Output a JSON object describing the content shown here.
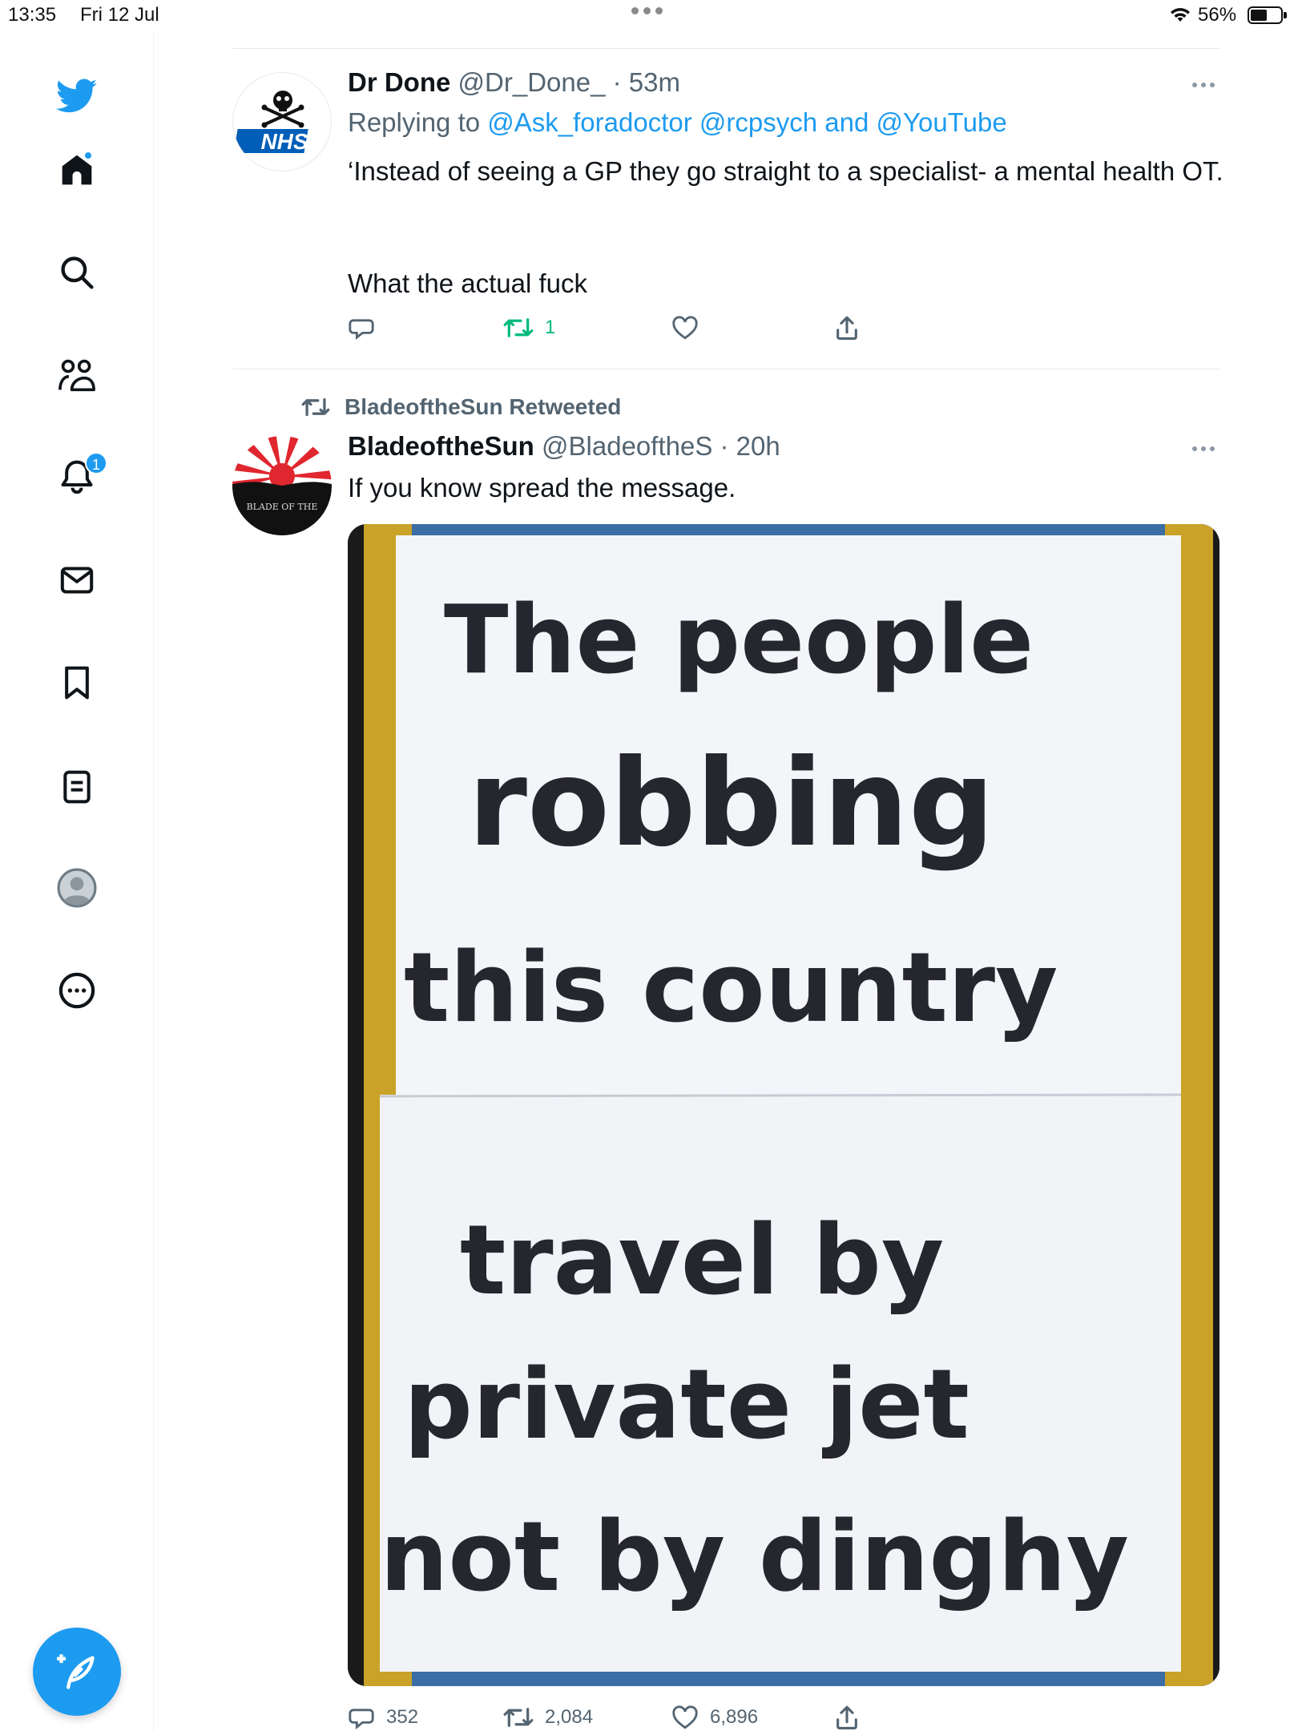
{
  "status_bar": {
    "time": "13:35",
    "date": "Fri 12 Jul",
    "battery_percent": "56%",
    "battery_level": 0.56
  },
  "sidebar": {
    "items": [
      {
        "name": "twitter-logo",
        "icon": "twitter-bird-icon"
      },
      {
        "name": "home",
        "icon": "home-icon",
        "has_dot": true
      },
      {
        "name": "explore",
        "icon": "search-icon"
      },
      {
        "name": "communities",
        "icon": "communities-icon"
      },
      {
        "name": "notifications",
        "icon": "bell-icon",
        "badge": "1"
      },
      {
        "name": "messages",
        "icon": "envelope-icon"
      },
      {
        "name": "bookmarks",
        "icon": "bookmark-icon"
      },
      {
        "name": "lists",
        "icon": "list-icon"
      },
      {
        "name": "profile",
        "icon": "avatar-icon"
      },
      {
        "name": "more",
        "icon": "more-circle-icon"
      }
    ],
    "compose_icon": "compose-feather-icon",
    "accent_color": "#1d9bf0"
  },
  "tweets": [
    {
      "display_name": "Dr Done",
      "handle": "@Dr_Done_",
      "time": "· 53m",
      "reply_prefix": "Replying to ",
      "reply_mention_1": "@Ask_foradoctor",
      "reply_mention_2": "@rcpsych",
      "reply_and": " and ",
      "reply_mention_3": "@YouTube",
      "text_line_1": "‘Instead of seeing a GP they go straight to a specialist- a mental health OT.",
      "text_line_2": "What the actual fuck",
      "avatar_label": "NHS",
      "actions": {
        "replies": "",
        "retweets": "1",
        "likes": ""
      }
    },
    {
      "retweeted_by": "BladeoftheSun Retweeted",
      "display_name": "BladeoftheSun",
      "handle": "@BladeoftheS",
      "time": "· 20h",
      "text": "If you know spread the message.",
      "avatar_label": "BLADE OF THE",
      "media_sign": {
        "lines": [
          "The people",
          "robbing",
          "this country",
          "travel by",
          "private jet",
          "not by dinghy"
        ]
      },
      "actions": {
        "replies": "352",
        "retweets": "2,084",
        "likes": "6,896"
      }
    }
  ]
}
